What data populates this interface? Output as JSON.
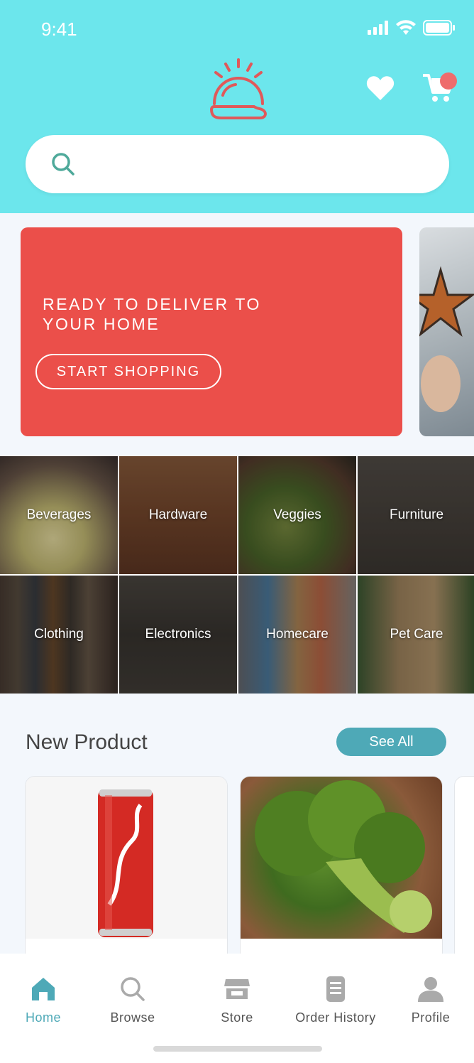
{
  "status": {
    "time": "9:41"
  },
  "search": {
    "placeholder": ""
  },
  "banner": {
    "title": "READY TO DELIVER TO\nYOUR HOME",
    "button": "START SHOPPING"
  },
  "categories": [
    {
      "label": "Beverages"
    },
    {
      "label": "Hardware"
    },
    {
      "label": "Veggies"
    },
    {
      "label": "Furniture"
    },
    {
      "label": "Clothing"
    },
    {
      "label": "Electronics"
    },
    {
      "label": "Homecare"
    },
    {
      "label": "Pet Care"
    }
  ],
  "new_product": {
    "title": "New Product",
    "see_all": "See All"
  },
  "nav": {
    "items": [
      {
        "label": "Home",
        "icon": "home-icon"
      },
      {
        "label": "Browse",
        "icon": "search-icon"
      },
      {
        "label": "Store",
        "icon": "store-icon"
      },
      {
        "label": "Order History",
        "icon": "receipt-icon"
      },
      {
        "label": "Profile",
        "icon": "user-icon"
      }
    ]
  },
  "colors": {
    "header": "#6ce6ec",
    "banner": "#eb4f4a",
    "accent": "#4ea9b7",
    "logo": "#e0595a",
    "badge": "#ee6c6c"
  }
}
